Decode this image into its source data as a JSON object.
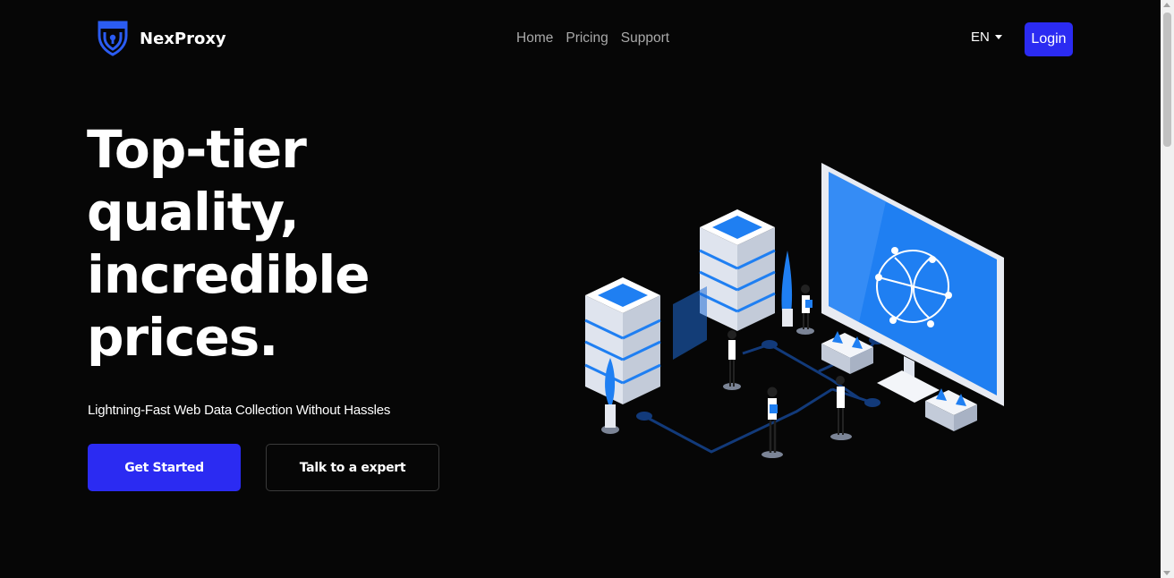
{
  "brand": {
    "name": "NexProxy",
    "logo_icon": "shield-lock-icon",
    "accent_color": "#2b2bf2"
  },
  "nav": {
    "links": [
      "Home",
      "Pricing",
      "Support"
    ],
    "language": "EN",
    "login_label": "Login"
  },
  "hero": {
    "title_lines": [
      "Top-tier",
      "quality,",
      "incredible",
      "prices."
    ],
    "subtitle": "Lightning-Fast Web Data Collection Without Hassles",
    "primary_cta": "Get Started",
    "secondary_cta": "Talk to a expert",
    "illustration": "isometric-servers-monitor-illustration"
  }
}
